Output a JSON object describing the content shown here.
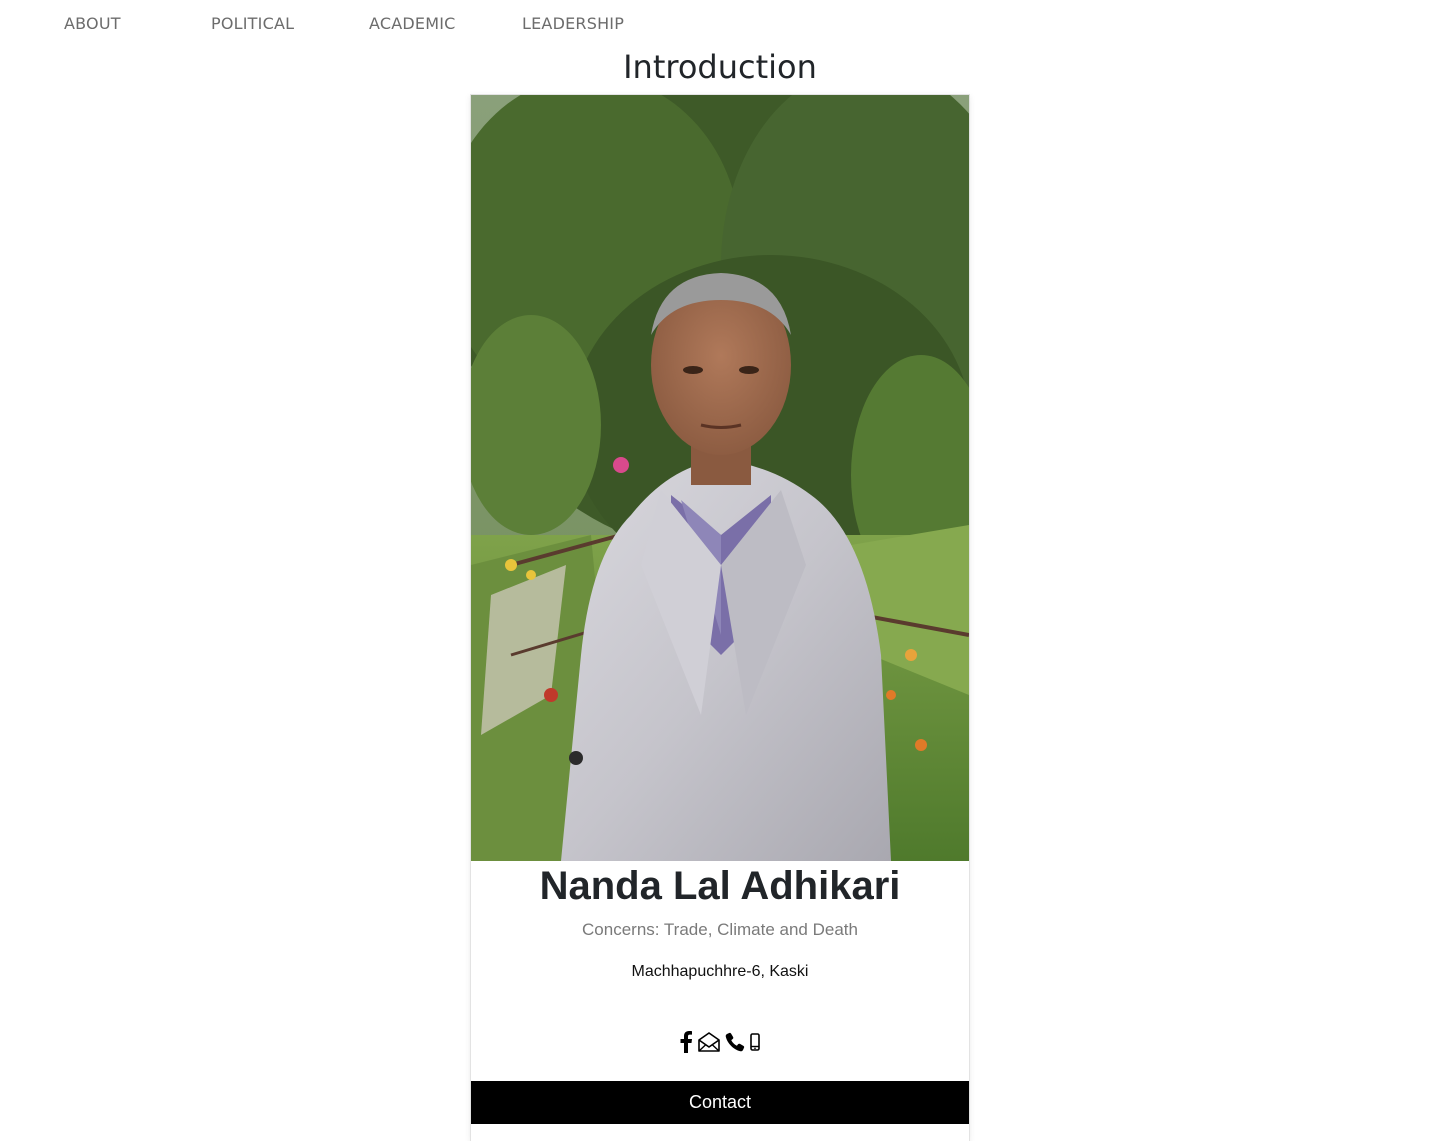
{
  "nav": {
    "items": [
      {
        "label": "ABOUT"
      },
      {
        "label": "POLITICAL"
      },
      {
        "label": "ACADEMIC"
      },
      {
        "label": "LEADERSHIP"
      }
    ]
  },
  "page": {
    "title": "Introduction"
  },
  "profile": {
    "name": "Nanda Lal Adhikari",
    "concerns": "Concerns: Trade, Climate and Death",
    "address": "Machhapuchhre-6, Kaski",
    "photo_alt": "Nanda Lal Adhikari",
    "social_icons": [
      "facebook-icon",
      "envelope-icon",
      "phone-icon",
      "mobile-icon"
    ],
    "contact_label": "Contact"
  },
  "colors": {
    "nav_text": "#6c6c6c",
    "button_bg": "#000000",
    "button_text": "#ffffff",
    "subtitle_text": "#7a7a7a"
  }
}
